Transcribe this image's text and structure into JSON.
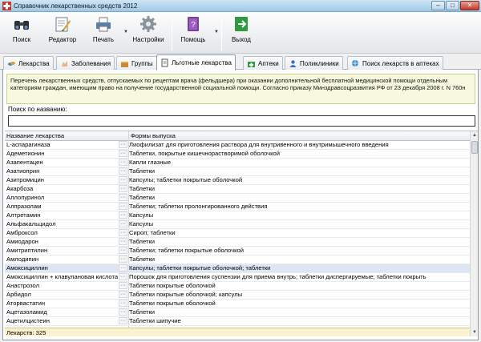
{
  "window": {
    "title": "Справочник лекарственных средств 2012"
  },
  "toolbar": {
    "search": "Поиск",
    "editor": "Редактор",
    "print": "Печать",
    "settings": "Настройки",
    "help": "Помощь",
    "exit": "Выход"
  },
  "tabs": [
    {
      "label": "Лекарства",
      "icon": "pills-icon"
    },
    {
      "label": "Заболевания",
      "icon": "hand-icon"
    },
    {
      "label": "Группы",
      "icon": "box-icon"
    },
    {
      "label": "Льготные лекарства",
      "icon": "document-icon",
      "active": true
    },
    {
      "label": "Аптеки",
      "icon": "pharmacy-icon"
    },
    {
      "label": "Поликлиники",
      "icon": "doctor-icon"
    },
    {
      "label": "Поиск лекарств в аптеках",
      "icon": "search-globe-icon"
    }
  ],
  "info_text": "Перечень лекарственных средств, отпускаемых по рецептам врача (фельдшера) при оказании дополнительной бесплатной медицинской помощи отдельным категориям граждан, имеющим право на получение государственной социальной помощи. Согласно приказу Минздравсоцразвития РФ от 23 декабря 2008 г. N 760н",
  "search": {
    "label": "Поиск по названию:",
    "value": ""
  },
  "grid": {
    "columns": [
      "Название лекарства",
      "Формы выпуска"
    ],
    "rows": [
      [
        "L-аспарагиназа",
        "Лиофилизат для приготовления раствора для внутривенного и внутримышечного введения"
      ],
      [
        "Адеметионин",
        "Таблетки, покрытые кишечнорастворимой оболочкой"
      ],
      [
        "Азапентацен",
        "Капли глазные"
      ],
      [
        "Азатиоприн",
        "Таблетки"
      ],
      [
        "Азитромицин",
        "Капсулы; таблетки покрытые оболочкой"
      ],
      [
        "Акарбоза",
        "Таблетки"
      ],
      [
        "Аллопуринол",
        "Таблетки"
      ],
      [
        "Алпразолам",
        "Таблетки; таблетки пролонгированного действия"
      ],
      [
        "Алтретамин",
        "Капсулы"
      ],
      [
        "Альфакальцидол",
        "Капсулы"
      ],
      [
        "Амброксол",
        "Сироп; таблетки"
      ],
      [
        "Амиодарон",
        "Таблетки"
      ],
      [
        "Амитриптилин",
        "Таблетки; таблетки покрытые оболочкой"
      ],
      [
        "Амлодипин",
        "Таблетки"
      ],
      [
        "Амоксициллин",
        "Капсулы; таблетки покрытые оболочкой; таблетки"
      ],
      [
        "Амоксициллин + клавулановая кислота",
        "Порошок для приготовления суспензии для приема внутрь; таблетки диспергируемые; таблетки покрыть"
      ],
      [
        "Анастрозол",
        "Таблетки покрытые оболочкой"
      ],
      [
        "Арбидол",
        "Таблетки покрытые оболочкой; капсулы"
      ],
      [
        "Аторвастатин",
        "Таблетки покрытые оболочкой"
      ],
      [
        "Ацетазоламид",
        "Таблетки"
      ],
      [
        "Ацетилцистеин",
        "Таблетки шипучие"
      ]
    ],
    "selected_row": 14
  },
  "footer": {
    "count_text": "Лекарств: 325"
  }
}
